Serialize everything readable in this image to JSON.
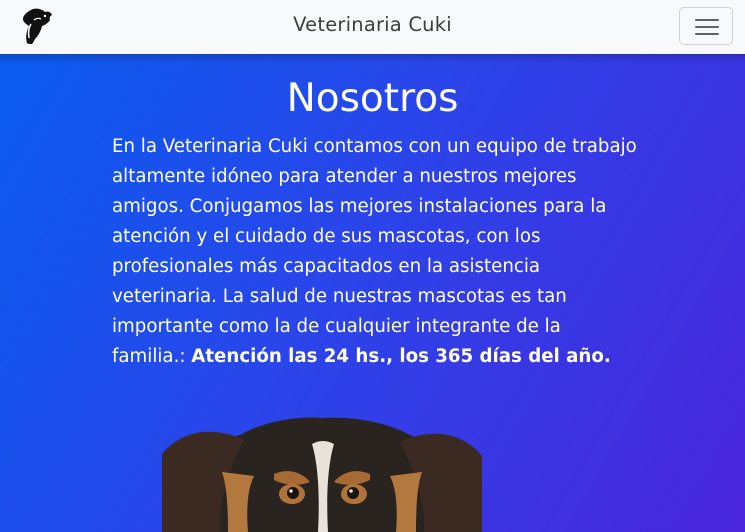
{
  "navbar": {
    "brand_title": "Veterinaria Cuki",
    "logo_icon": "dog-head-logo-icon",
    "menu_icon": "hamburger-menu-icon"
  },
  "about": {
    "title": "Nosotros",
    "body": "En la Veterinaria Cuki contamos con un equipo de trabajo altamente idóneo para atender a nuestros mejores amigos. Conjugamos las mejores instalaciones para la atención y el cuidado de sus mascotas, con los profesionales más capacitados en la asistencia veterinaria. La salud de nuestras mascotas es tan importante como la de cualquier integrante de la familia.: ",
    "highlight": "Atención las 24 hs., los 365 días del año."
  },
  "colors": {
    "navbar_bg": "#f8f9fa",
    "hero_gradient_start": "#0a5cf0",
    "hero_gradient_end": "#4a25db",
    "text_light": "#ffffff"
  }
}
